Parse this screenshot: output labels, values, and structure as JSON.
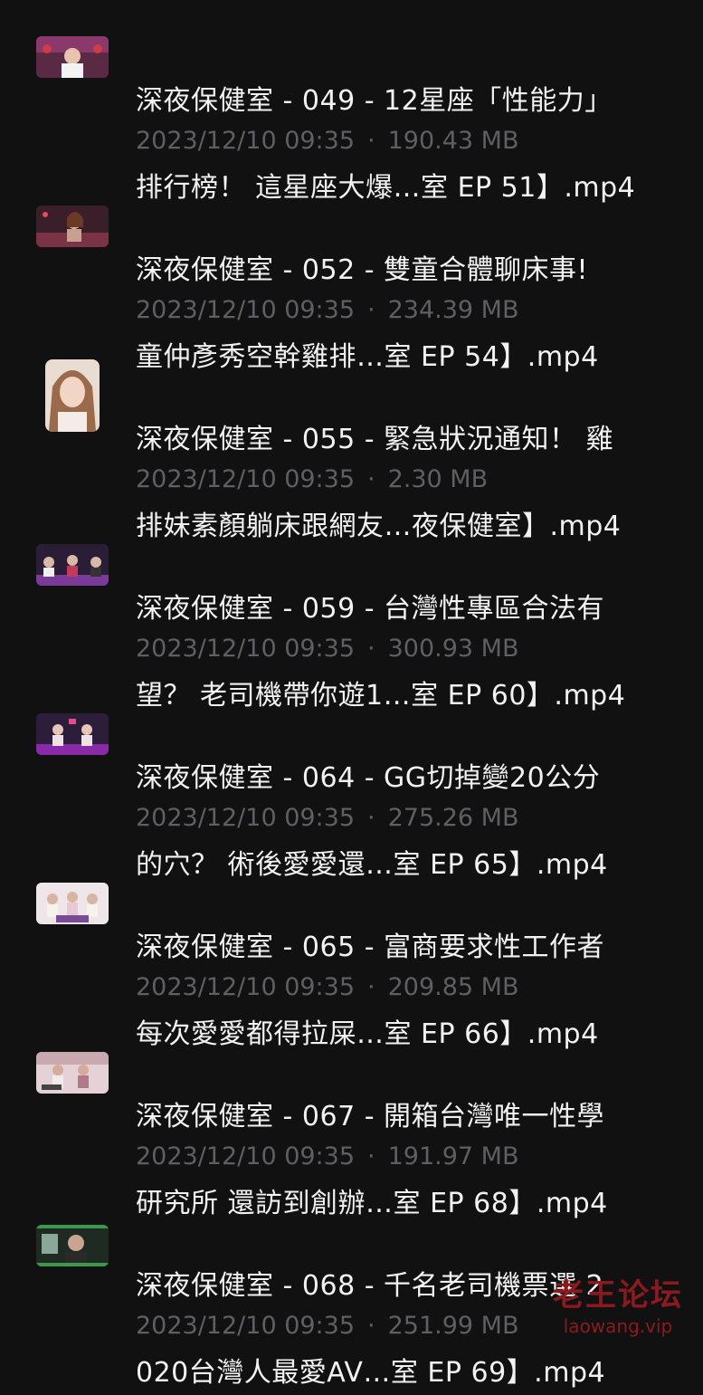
{
  "files": [
    {
      "title_line1": "深夜保健室 - 049 - 12星座「性能力」",
      "title_line2": "排行榜！ 這星座大爆…室 EP 51】.mp4",
      "date": "2023/12/10 09:35",
      "size": "190.43 MB",
      "thumb_icon": "video-thumbnail-pink-studio"
    },
    {
      "title_line1": "深夜保健室 - 052 - 雙童合體聊床事!",
      "title_line2": "童仲彥秀空幹雞排…室 EP 54】.mp4",
      "date": "2023/12/10 09:35",
      "size": "234.39 MB",
      "thumb_icon": "video-thumbnail-host"
    },
    {
      "title_line1": "深夜保健室 - 055 - 緊急狀況通知！ 雞",
      "title_line2": "排妹素顏躺床跟網友…夜保健室】.mp4",
      "date": "2023/12/10 09:35",
      "size": "2.30 MB",
      "thumb_icon": "video-thumbnail-portrait"
    },
    {
      "title_line1": "深夜保健室 - 059 - 台灣性專區合法有",
      "title_line2": "望？ 老司機帶你遊1…室 EP 60】.mp4",
      "date": "2023/12/10 09:35",
      "size": "300.93 MB",
      "thumb_icon": "video-thumbnail-panel"
    },
    {
      "title_line1": "深夜保健室 - 064 - GG切掉變20公分",
      "title_line2": "的穴？ 術後愛愛還…室 EP 65】.mp4",
      "date": "2023/12/10 09:35",
      "size": "275.26 MB",
      "thumb_icon": "video-thumbnail-panel"
    },
    {
      "title_line1": "深夜保健室 - 065 - 富商要求性工作者",
      "title_line2": "每次愛愛都得拉屎…室 EP 66】.mp4",
      "date": "2023/12/10 09:35",
      "size": "209.85 MB",
      "thumb_icon": "video-thumbnail-bright"
    },
    {
      "title_line1": "深夜保健室 - 067 - 開箱台灣唯一性學",
      "title_line2": "研究所 還訪到創辦…室 EP 68】.mp4",
      "date": "2023/12/10 09:35",
      "size": "191.97 MB",
      "thumb_icon": "video-thumbnail-bright"
    },
    {
      "title_line1": "深夜保健室 - 068 - 千名老司機票選 2",
      "title_line2": "020台灣人最愛AV…室 EP 69】.mp4",
      "date": "2023/12/10 09:35",
      "size": "251.99 MB",
      "thumb_icon": "video-thumbnail-green"
    }
  ],
  "meta_separator": "·",
  "watermark": {
    "name": "老王论坛",
    "url": "laowang.vip"
  },
  "colors": {
    "background": "#111112",
    "title_text": "#f2f2f2",
    "meta_text": "#5f5f63",
    "watermark": "#8b1a1f"
  }
}
